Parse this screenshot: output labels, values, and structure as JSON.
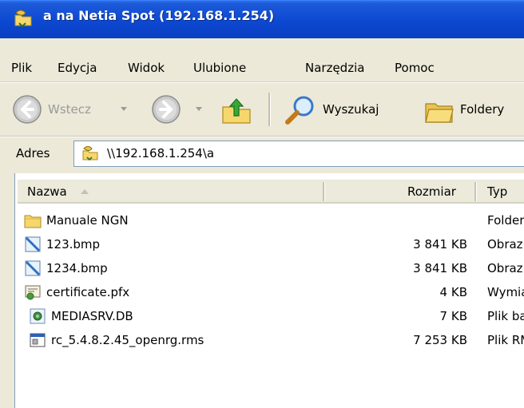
{
  "window": {
    "title": "a na Netia Spot (192.168.1.254)"
  },
  "menu": {
    "items": [
      "Plik",
      "Edycja",
      "Widok",
      "Ulubione",
      "Narzędzia",
      "Pomoc"
    ]
  },
  "toolbar": {
    "back_label": "Wstecz",
    "search_label": "Wyszukaj",
    "folders_label": "Foldery"
  },
  "address": {
    "label": "Adres",
    "value": "\\\\192.168.1.254\\a"
  },
  "columns": {
    "name": "Nazwa",
    "size": "Rozmiar",
    "type": "Typ"
  },
  "files": [
    {
      "name": "Manuale NGN",
      "size": "",
      "type": "Folder",
      "icon": "folder-icon"
    },
    {
      "name": "123.bmp",
      "size": "3 841 KB",
      "type": "Obraz",
      "icon": "bitmap-icon"
    },
    {
      "name": "1234.bmp",
      "size": "3 841 KB",
      "type": "Obraz",
      "icon": "bitmap-icon"
    },
    {
      "name": "certificate.pfx",
      "size": "4 KB",
      "type": "Wymiana",
      "icon": "certificate-icon"
    },
    {
      "name": "MEDIASRV.DB",
      "size": "7 KB",
      "type": "Plik bazy",
      "icon": "database-file-icon"
    },
    {
      "name": "rc_5.4.8.2.45_openrg.rms",
      "size": "7 253 KB",
      "type": "Plik RMS",
      "icon": "generic-file-icon"
    }
  ],
  "colors": {
    "titlebar": "#0c48d2",
    "chrome": "#ece9d8",
    "folder": "#f5d76e"
  }
}
